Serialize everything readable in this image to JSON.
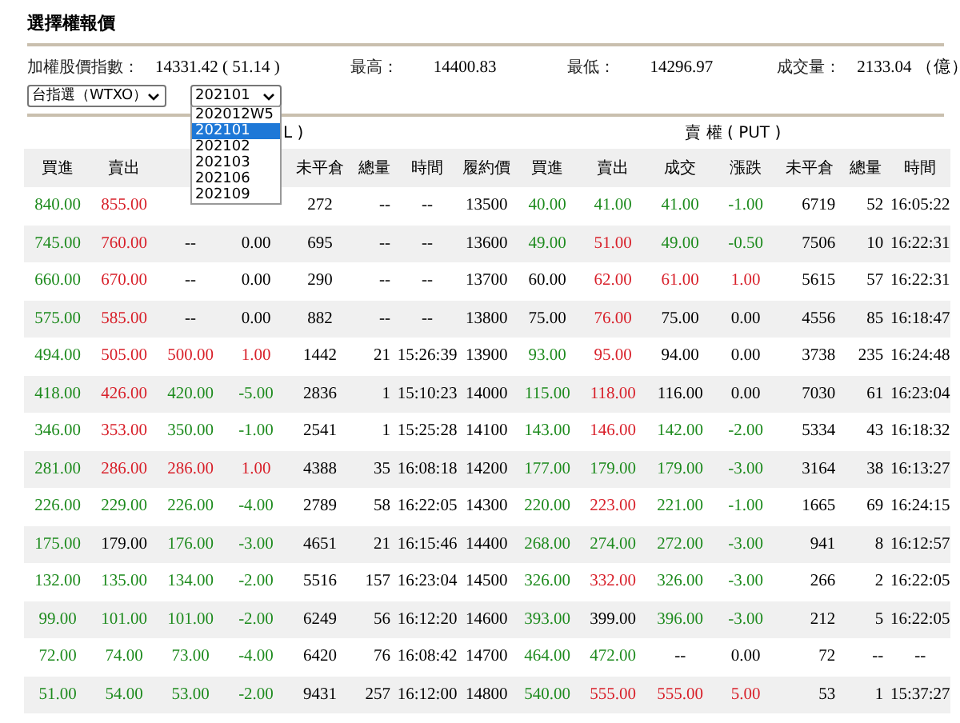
{
  "title": "選擇權報價",
  "quote": [
    {
      "label": "加權股價指數：",
      "value": "14331.42 ( 51.14 )"
    },
    {
      "label": "最高：",
      "value": "14400.83"
    },
    {
      "label": "最低：",
      "value": "14296.97"
    },
    {
      "label": "成交量：",
      "value": "2133.04 （億）"
    }
  ],
  "product_select": {
    "value": "台指選（WTXO）"
  },
  "month_select": {
    "value": "202101",
    "expanded": true,
    "options": [
      {
        "label": "202012W5",
        "selected": false
      },
      {
        "label": "202101",
        "selected": true
      },
      {
        "label": "202102",
        "selected": false
      },
      {
        "label": "202103",
        "selected": false
      },
      {
        "label": "202106",
        "selected": false
      },
      {
        "label": "202109",
        "selected": false
      }
    ]
  },
  "call_header": "L )",
  "put_header": "賣 權 ( PUT )",
  "columns": [
    "買進",
    "賣出",
    null,
    null,
    "未平倉",
    "總量",
    "時間",
    "履約價",
    "買進",
    "賣出",
    "成交",
    "漲跌",
    "未平倉",
    "總量",
    "時間"
  ],
  "rows": [
    {
      "cells": [
        {
          "text": "840.00",
          "color": "#1e8b1e"
        },
        {
          "text": "855.00",
          "color": "#d8202a"
        },
        null,
        null,
        {
          "text": "272"
        },
        {
          "text": "--"
        },
        {
          "text": "--"
        },
        {
          "text": "13500"
        },
        {
          "text": "40.00",
          "color": "#1e8b1e"
        },
        {
          "text": "41.00",
          "color": "#1e8b1e"
        },
        {
          "text": "41.00",
          "color": "#1e8b1e"
        },
        {
          "text": "-1.00",
          "color": "#1e8b1e"
        },
        {
          "text": "6719"
        },
        {
          "text": "52"
        },
        {
          "text": "16:05:22"
        }
      ]
    },
    {
      "cells": [
        {
          "text": "745.00",
          "color": "#1e8b1e"
        },
        {
          "text": "760.00",
          "color": "#d8202a"
        },
        {
          "text": "--"
        },
        {
          "text": "0.00"
        },
        {
          "text": "695"
        },
        {
          "text": "--"
        },
        {
          "text": "--"
        },
        {
          "text": "13600"
        },
        {
          "text": "49.00",
          "color": "#1e8b1e"
        },
        {
          "text": "51.00",
          "color": "#d8202a"
        },
        {
          "text": "49.00",
          "color": "#1e8b1e"
        },
        {
          "text": "-0.50",
          "color": "#1e8b1e"
        },
        {
          "text": "7506"
        },
        {
          "text": "10"
        },
        {
          "text": "16:22:31"
        }
      ]
    },
    {
      "cells": [
        {
          "text": "660.00",
          "color": "#1e8b1e"
        },
        {
          "text": "670.00",
          "color": "#d8202a"
        },
        {
          "text": "--"
        },
        {
          "text": "0.00"
        },
        {
          "text": "290"
        },
        {
          "text": "--"
        },
        {
          "text": "--"
        },
        {
          "text": "13700"
        },
        {
          "text": "60.00"
        },
        {
          "text": "62.00",
          "color": "#d8202a"
        },
        {
          "text": "61.00",
          "color": "#d8202a"
        },
        {
          "text": "1.00",
          "color": "#d8202a"
        },
        {
          "text": "5615"
        },
        {
          "text": "57"
        },
        {
          "text": "16:22:31"
        }
      ]
    },
    {
      "cells": [
        {
          "text": "575.00",
          "color": "#1e8b1e"
        },
        {
          "text": "585.00",
          "color": "#d8202a"
        },
        {
          "text": "--"
        },
        {
          "text": "0.00"
        },
        {
          "text": "882"
        },
        {
          "text": "--"
        },
        {
          "text": "--"
        },
        {
          "text": "13800"
        },
        {
          "text": "75.00"
        },
        {
          "text": "76.00",
          "color": "#d8202a"
        },
        {
          "text": "75.00"
        },
        {
          "text": "0.00"
        },
        {
          "text": "4556"
        },
        {
          "text": "85"
        },
        {
          "text": "16:18:47"
        }
      ]
    },
    {
      "cells": [
        {
          "text": "494.00",
          "color": "#1e8b1e"
        },
        {
          "text": "505.00",
          "color": "#d8202a"
        },
        {
          "text": "500.00",
          "color": "#d8202a"
        },
        {
          "text": "1.00",
          "color": "#d8202a"
        },
        {
          "text": "1442"
        },
        {
          "text": "21"
        },
        {
          "text": "15:26:39"
        },
        {
          "text": "13900"
        },
        {
          "text": "93.00",
          "color": "#1e8b1e"
        },
        {
          "text": "95.00",
          "color": "#d8202a"
        },
        {
          "text": "94.00"
        },
        {
          "text": "0.00"
        },
        {
          "text": "3738"
        },
        {
          "text": "235"
        },
        {
          "text": "16:24:48"
        }
      ]
    },
    {
      "cells": [
        {
          "text": "418.00",
          "color": "#1e8b1e"
        },
        {
          "text": "426.00",
          "color": "#d8202a"
        },
        {
          "text": "420.00",
          "color": "#1e8b1e"
        },
        {
          "text": "-5.00",
          "color": "#1e8b1e"
        },
        {
          "text": "2836"
        },
        {
          "text": "1"
        },
        {
          "text": "15:10:23"
        },
        {
          "text": "14000"
        },
        {
          "text": "115.00",
          "color": "#1e8b1e"
        },
        {
          "text": "118.00",
          "color": "#d8202a"
        },
        {
          "text": "116.00"
        },
        {
          "text": "0.00"
        },
        {
          "text": "7030"
        },
        {
          "text": "61"
        },
        {
          "text": "16:23:04"
        }
      ]
    },
    {
      "cells": [
        {
          "text": "346.00",
          "color": "#1e8b1e"
        },
        {
          "text": "353.00",
          "color": "#d8202a"
        },
        {
          "text": "350.00",
          "color": "#1e8b1e"
        },
        {
          "text": "-1.00",
          "color": "#1e8b1e"
        },
        {
          "text": "2541"
        },
        {
          "text": "1"
        },
        {
          "text": "15:25:28"
        },
        {
          "text": "14100"
        },
        {
          "text": "143.00",
          "color": "#1e8b1e"
        },
        {
          "text": "146.00",
          "color": "#d8202a"
        },
        {
          "text": "142.00",
          "color": "#1e8b1e"
        },
        {
          "text": "-2.00",
          "color": "#1e8b1e"
        },
        {
          "text": "5334"
        },
        {
          "text": "43"
        },
        {
          "text": "16:18:32"
        }
      ]
    },
    {
      "cells": [
        {
          "text": "281.00",
          "color": "#1e8b1e"
        },
        {
          "text": "286.00",
          "color": "#d8202a"
        },
        {
          "text": "286.00",
          "color": "#d8202a"
        },
        {
          "text": "1.00",
          "color": "#d8202a"
        },
        {
          "text": "4388"
        },
        {
          "text": "35"
        },
        {
          "text": "16:08:18"
        },
        {
          "text": "14200"
        },
        {
          "text": "177.00",
          "color": "#1e8b1e"
        },
        {
          "text": "179.00",
          "color": "#1e8b1e"
        },
        {
          "text": "179.00",
          "color": "#1e8b1e"
        },
        {
          "text": "-3.00",
          "color": "#1e8b1e"
        },
        {
          "text": "3164"
        },
        {
          "text": "38"
        },
        {
          "text": "16:13:27"
        }
      ]
    },
    {
      "cells": [
        {
          "text": "226.00",
          "color": "#1e8b1e"
        },
        {
          "text": "229.00",
          "color": "#1e8b1e"
        },
        {
          "text": "226.00",
          "color": "#1e8b1e"
        },
        {
          "text": "-4.00",
          "color": "#1e8b1e"
        },
        {
          "text": "2789"
        },
        {
          "text": "58"
        },
        {
          "text": "16:22:05"
        },
        {
          "text": "14300"
        },
        {
          "text": "220.00",
          "color": "#1e8b1e"
        },
        {
          "text": "223.00",
          "color": "#d8202a"
        },
        {
          "text": "221.00",
          "color": "#1e8b1e"
        },
        {
          "text": "-1.00",
          "color": "#1e8b1e"
        },
        {
          "text": "1665"
        },
        {
          "text": "69"
        },
        {
          "text": "16:24:15"
        }
      ]
    },
    {
      "cells": [
        {
          "text": "175.00",
          "color": "#1e8b1e"
        },
        {
          "text": "179.00"
        },
        {
          "text": "176.00",
          "color": "#1e8b1e"
        },
        {
          "text": "-3.00",
          "color": "#1e8b1e"
        },
        {
          "text": "4651"
        },
        {
          "text": "21"
        },
        {
          "text": "16:15:46"
        },
        {
          "text": "14400"
        },
        {
          "text": "268.00",
          "color": "#1e8b1e"
        },
        {
          "text": "274.00",
          "color": "#1e8b1e"
        },
        {
          "text": "272.00",
          "color": "#1e8b1e"
        },
        {
          "text": "-3.00",
          "color": "#1e8b1e"
        },
        {
          "text": "941"
        },
        {
          "text": "8"
        },
        {
          "text": "16:12:57"
        }
      ]
    },
    {
      "cells": [
        {
          "text": "132.00",
          "color": "#1e8b1e"
        },
        {
          "text": "135.00",
          "color": "#1e8b1e"
        },
        {
          "text": "134.00",
          "color": "#1e8b1e"
        },
        {
          "text": "-2.00",
          "color": "#1e8b1e"
        },
        {
          "text": "5516"
        },
        {
          "text": "157"
        },
        {
          "text": "16:23:04"
        },
        {
          "text": "14500"
        },
        {
          "text": "326.00",
          "color": "#1e8b1e"
        },
        {
          "text": "332.00",
          "color": "#d8202a"
        },
        {
          "text": "326.00",
          "color": "#1e8b1e"
        },
        {
          "text": "-3.00",
          "color": "#1e8b1e"
        },
        {
          "text": "266"
        },
        {
          "text": "2"
        },
        {
          "text": "16:22:05"
        }
      ]
    },
    {
      "cells": [
        {
          "text": "99.00",
          "color": "#1e8b1e"
        },
        {
          "text": "101.00",
          "color": "#1e8b1e"
        },
        {
          "text": "101.00",
          "color": "#1e8b1e"
        },
        {
          "text": "-2.00",
          "color": "#1e8b1e"
        },
        {
          "text": "6249"
        },
        {
          "text": "56"
        },
        {
          "text": "16:12:20"
        },
        {
          "text": "14600"
        },
        {
          "text": "393.00",
          "color": "#1e8b1e"
        },
        {
          "text": "399.00"
        },
        {
          "text": "396.00",
          "color": "#1e8b1e"
        },
        {
          "text": "-3.00",
          "color": "#1e8b1e"
        },
        {
          "text": "212"
        },
        {
          "text": "5"
        },
        {
          "text": "16:22:05"
        }
      ]
    },
    {
      "cells": [
        {
          "text": "72.00",
          "color": "#1e8b1e"
        },
        {
          "text": "74.00",
          "color": "#1e8b1e"
        },
        {
          "text": "73.00",
          "color": "#1e8b1e"
        },
        {
          "text": "-4.00",
          "color": "#1e8b1e"
        },
        {
          "text": "6420"
        },
        {
          "text": "76"
        },
        {
          "text": "16:08:42"
        },
        {
          "text": "14700"
        },
        {
          "text": "464.00",
          "color": "#1e8b1e"
        },
        {
          "text": "472.00",
          "color": "#1e8b1e"
        },
        {
          "text": "--"
        },
        {
          "text": "0.00"
        },
        {
          "text": "72"
        },
        {
          "text": "--"
        },
        {
          "text": "--"
        }
      ]
    },
    {
      "cells": [
        {
          "text": "51.00",
          "color": "#1e8b1e"
        },
        {
          "text": "54.00",
          "color": "#1e8b1e"
        },
        {
          "text": "53.00",
          "color": "#1e8b1e"
        },
        {
          "text": "-2.00",
          "color": "#1e8b1e"
        },
        {
          "text": "9431"
        },
        {
          "text": "257"
        },
        {
          "text": "16:12:00"
        },
        {
          "text": "14800"
        },
        {
          "text": "540.00",
          "color": "#1e8b1e"
        },
        {
          "text": "555.00",
          "color": "#d8202a"
        },
        {
          "text": "555.00",
          "color": "#d8202a"
        },
        {
          "text": "5.00",
          "color": "#d8202a"
        },
        {
          "text": "53"
        },
        {
          "text": "1"
        },
        {
          "text": "15:37:27"
        }
      ]
    }
  ]
}
